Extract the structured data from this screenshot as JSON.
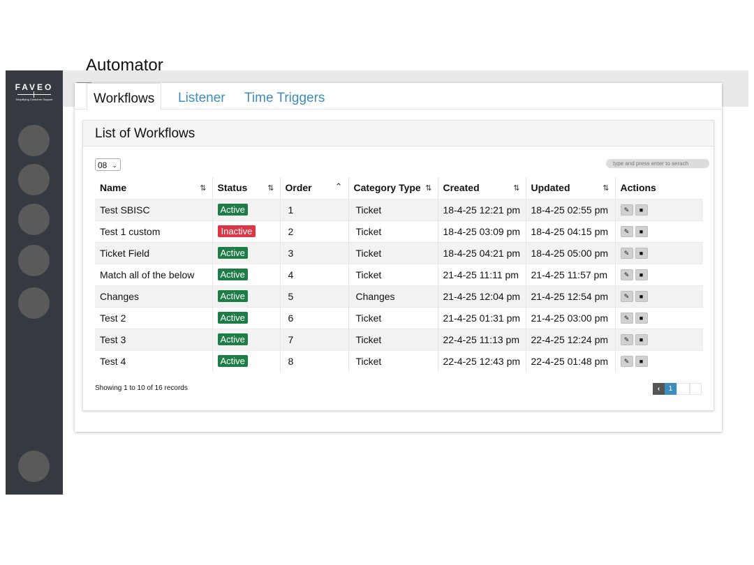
{
  "app": {
    "logo_text": "FAVEO",
    "logo_tagline": "Simplifying Customer Support"
  },
  "page": {
    "title": "Automator"
  },
  "tabs": [
    {
      "label": "Workflows",
      "active": true
    },
    {
      "label": "Listener",
      "active": false
    },
    {
      "label": "Time Triggers",
      "active": false
    }
  ],
  "panel": {
    "title": "List of Workflows",
    "per_page": "08",
    "search_placeholder": "type and press enter to serach"
  },
  "table": {
    "columns": [
      "Name",
      "Status",
      "Order",
      "Category Type",
      "Created",
      "Updated",
      "Actions"
    ],
    "rows": [
      {
        "name": "Test SBISC",
        "status": "Active",
        "order": "1",
        "category": "Ticket",
        "created": "18-4-25 12:21 pm",
        "updated": "18-4-25 02:55 pm"
      },
      {
        "name": "Test 1 custom",
        "status": "Inactive",
        "order": "2",
        "category": "Ticket",
        "created": "18-4-25 03:09 pm",
        "updated": "18-4-25 04:15 pm"
      },
      {
        "name": "Ticket Field",
        "status": "Active",
        "order": "3",
        "category": "Ticket",
        "created": "18-4-25 04:21 pm",
        "updated": "18-4-25 05:00 pm"
      },
      {
        "name": "Match all of the below",
        "status": "Active",
        "order": "4",
        "category": "Ticket",
        "created": "21-4-25 11:11 pm",
        "updated": "21-4-25 11:57 pm"
      },
      {
        "name": "Changes",
        "status": "Active",
        "order": "5",
        "category": "Changes",
        "created": "21-4-25 12:04 pm",
        "updated": "21-4-25 12:54 pm"
      },
      {
        "name": "Test 2",
        "status": "Active",
        "order": "6",
        "category": "Ticket",
        "created": "21-4-25 01:31 pm",
        "updated": "21-4-25 03:00 pm"
      },
      {
        "name": "Test 3",
        "status": "Active",
        "order": "7",
        "category": "Ticket",
        "created": "22-4-25 11:13 pm",
        "updated": "22-4-25 12:24 pm"
      },
      {
        "name": "Test 4",
        "status": "Active",
        "order": "8",
        "category": "Ticket",
        "created": "22-4-25 12:43 pm",
        "updated": "22-4-25 01:48 pm"
      }
    ]
  },
  "footer": {
    "showing": "Showing 1 to 10 of 16 records",
    "current_page": "1"
  },
  "icons": {
    "sort": "sort-arrows-icon",
    "sort_up": "chevron-up-icon",
    "edit": "edit-icon",
    "delete": "trash-icon",
    "prev": "chevron-left-icon",
    "menu": "hamburger-menu-icon"
  },
  "colors": {
    "sidebar": "#343a40",
    "active_badge": "#1e7d46",
    "inactive_badge": "#dc3545",
    "link": "#3c8dbc"
  }
}
